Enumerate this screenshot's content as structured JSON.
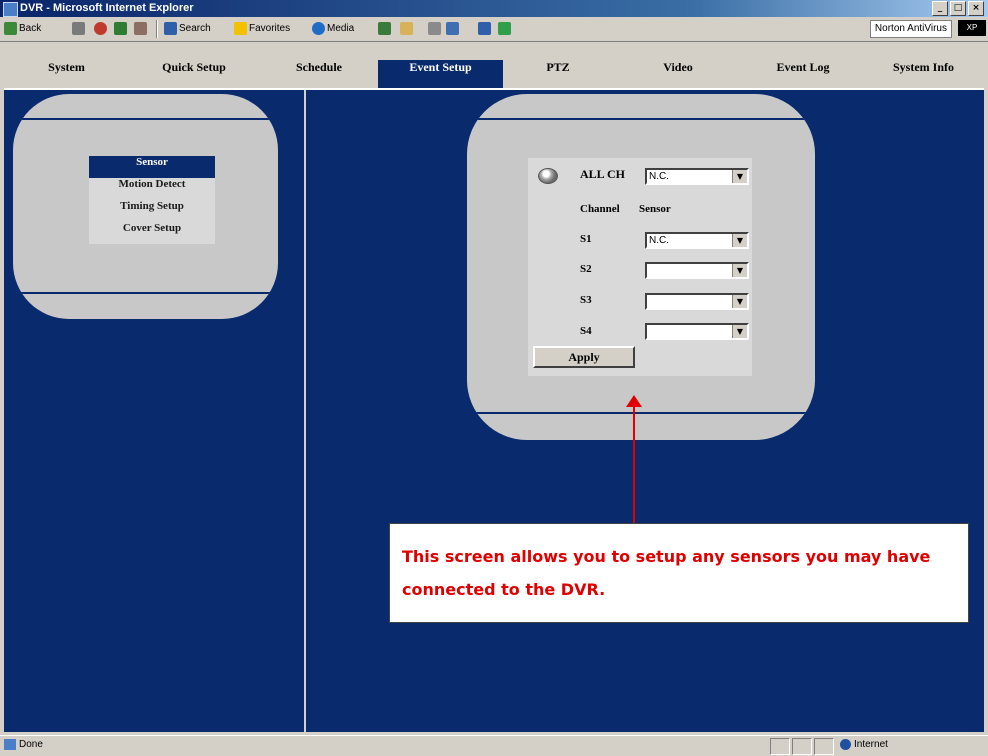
{
  "window": {
    "title": "DVR - Microsoft Internet Explorer",
    "controls": [
      "_",
      "□",
      "×"
    ]
  },
  "toolbar": {
    "back": "Back",
    "search": "Search",
    "favorites": "Favorites",
    "media": "Media",
    "norton": "Norton AntiVirus",
    "brand": "XP"
  },
  "nav": {
    "items": [
      "System",
      "Quick Setup",
      "Schedule",
      "Event Setup",
      "PTZ",
      "Video",
      "Event Log",
      "System Info"
    ],
    "active": "Event Setup"
  },
  "submenu": {
    "items": [
      "Sensor",
      "Motion Detect",
      "Timing Setup",
      "Cover Setup"
    ],
    "active": "Sensor"
  },
  "sensor_form": {
    "all_ch_label": "ALL CH",
    "all_ch_value": "N.C.",
    "header_channel": "Channel",
    "header_sensor": "Sensor",
    "rows": [
      {
        "channel": "S1",
        "value": "N.C."
      },
      {
        "channel": "S2",
        "value": ""
      },
      {
        "channel": "S3",
        "value": ""
      },
      {
        "channel": "S4",
        "value": ""
      }
    ],
    "apply_label": "Apply"
  },
  "callout": {
    "text": "This screen allows you to setup any sensors you may have connected to the DVR."
  },
  "status": {
    "left": "Done",
    "zone": "Internet"
  },
  "colors": {
    "frame_blue": "#0a2a6e",
    "panel_gray": "#c8c8c8",
    "callout_red": "#e00000"
  }
}
